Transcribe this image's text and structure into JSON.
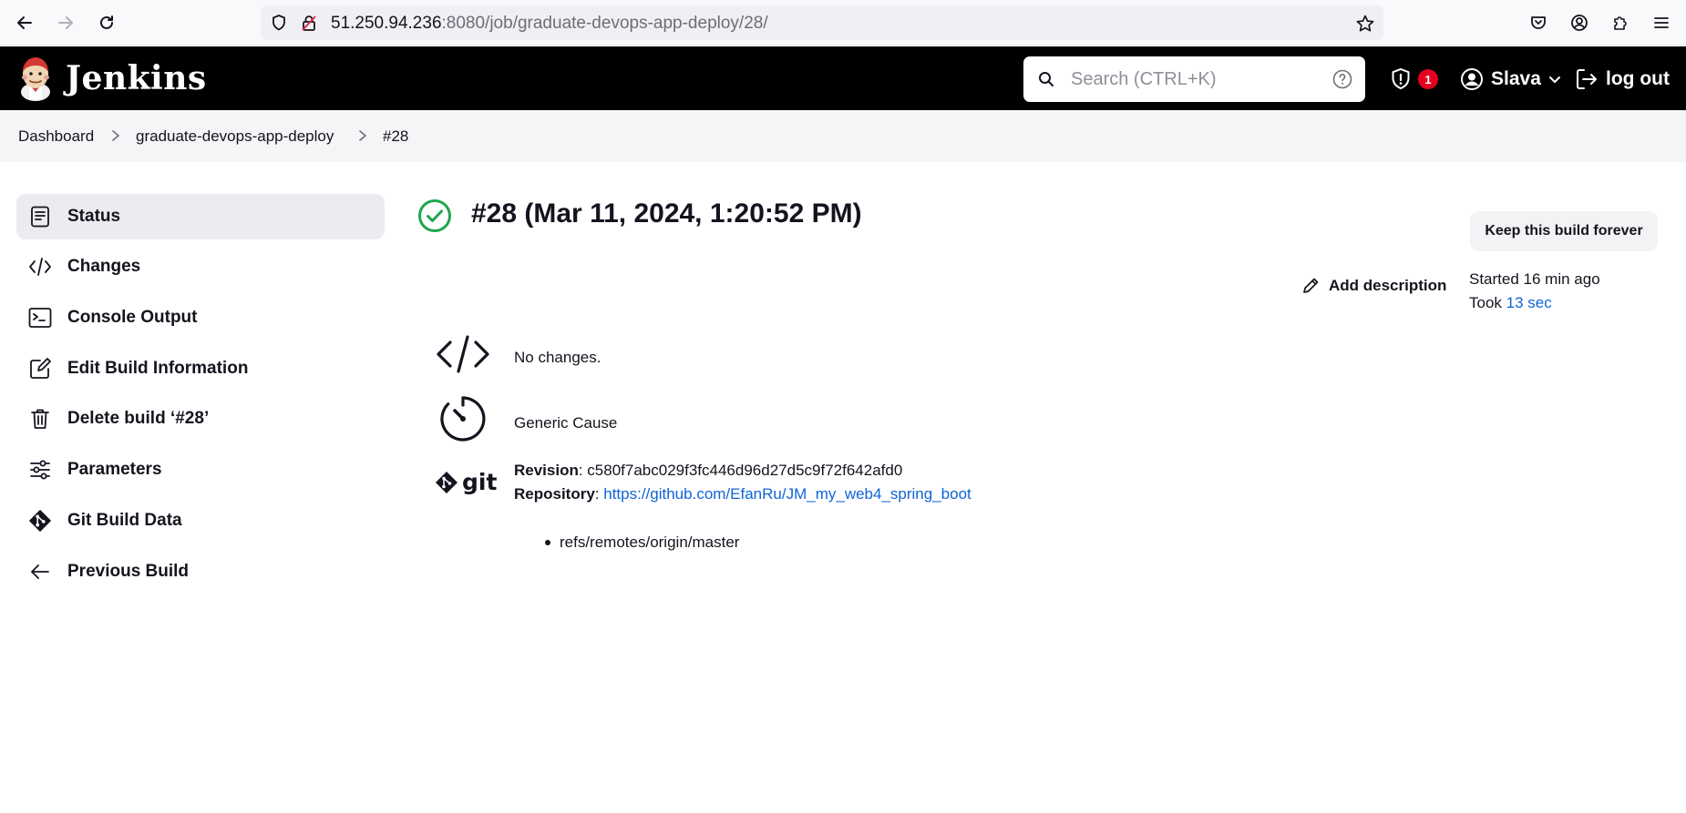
{
  "browser": {
    "url_host": "51.250.94.236",
    "url_rest": ":8080/job/graduate-devops-app-deploy/28/"
  },
  "header": {
    "app_name": "Jenkins",
    "search_placeholder": "Search (CTRL+K)",
    "security_badge_count": "1",
    "user_name": "Slava",
    "logout_label": "log out"
  },
  "breadcrumb": [
    "Dashboard",
    "graduate-devops-app-deploy",
    "#28"
  ],
  "sidebar": {
    "items": [
      {
        "label": "Status",
        "icon": "document-icon"
      },
      {
        "label": "Changes",
        "icon": "code-icon"
      },
      {
        "label": "Console Output",
        "icon": "terminal-icon"
      },
      {
        "label": "Edit Build Information",
        "icon": "edit-icon"
      },
      {
        "label": "Delete build ‘#28’",
        "icon": "trash-icon"
      },
      {
        "label": "Parameters",
        "icon": "sliders-icon"
      },
      {
        "label": "Git Build Data",
        "icon": "git-icon"
      },
      {
        "label": "Previous Build",
        "icon": "arrow-left-icon"
      }
    ]
  },
  "build": {
    "title": "#28 (Mar 11, 2024, 1:20:52 PM)",
    "keep_button": "Keep this build forever",
    "add_description": "Add description",
    "started": "Started 16 min ago",
    "took_prefix": "Took ",
    "took_link": "13 sec",
    "changes_text": "No changes.",
    "cause_text": "Generic Cause",
    "git_logo_text": "git",
    "revision_label": "Revision",
    "revision_value": ": c580f7abc029f3fc446d96d27d5c9f72f642afd0",
    "repository_label": "Repository",
    "repository_sep": ": ",
    "repository_url": "https://github.com/EfanRu/JM_my_web4_spring_boot",
    "branch": "refs/remotes/origin/master"
  },
  "colors": {
    "success": "#1ea64b",
    "link": "#1064d8",
    "header_bg": "#000000",
    "badge": "#e6001f"
  }
}
